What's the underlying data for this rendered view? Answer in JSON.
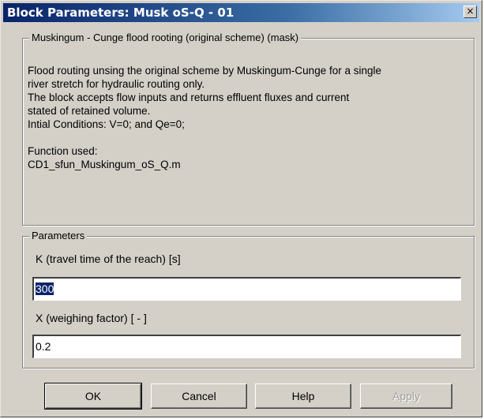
{
  "window": {
    "title": "Block Parameters: Musk oS-Q - 01",
    "close_glyph": "×"
  },
  "description": {
    "legend": "Muskingum - Cunge flood rooting (original scheme) (mask)",
    "lines": [
      "Flood routing unsing the original scheme by Muskingum-Cunge for a single",
      "river stretch for hydraulic routing only.",
      "The block accepts flow inputs and returns effluent fluxes and current",
      "stated of retained volume.",
      "Intial Conditions: V=0; and Qe=0;",
      "",
      "Function used:",
      "CD1_sfun_Muskingum_oS_Q.m"
    ]
  },
  "parameters": {
    "legend": "Parameters",
    "k_label": "K (travel time of the reach) [s]",
    "k_value": "300",
    "x_label": "X (weighing factor)  [ - ]",
    "x_value": "0.2"
  },
  "buttons": {
    "ok": "OK",
    "cancel": "Cancel",
    "help": "Help",
    "apply": "Apply"
  },
  "colors": {
    "titlebar_start": "#0a246a",
    "titlebar_end": "#a6caf0",
    "dialog_face": "#d4d0c8",
    "disabled_text": "#a0a0a0"
  }
}
